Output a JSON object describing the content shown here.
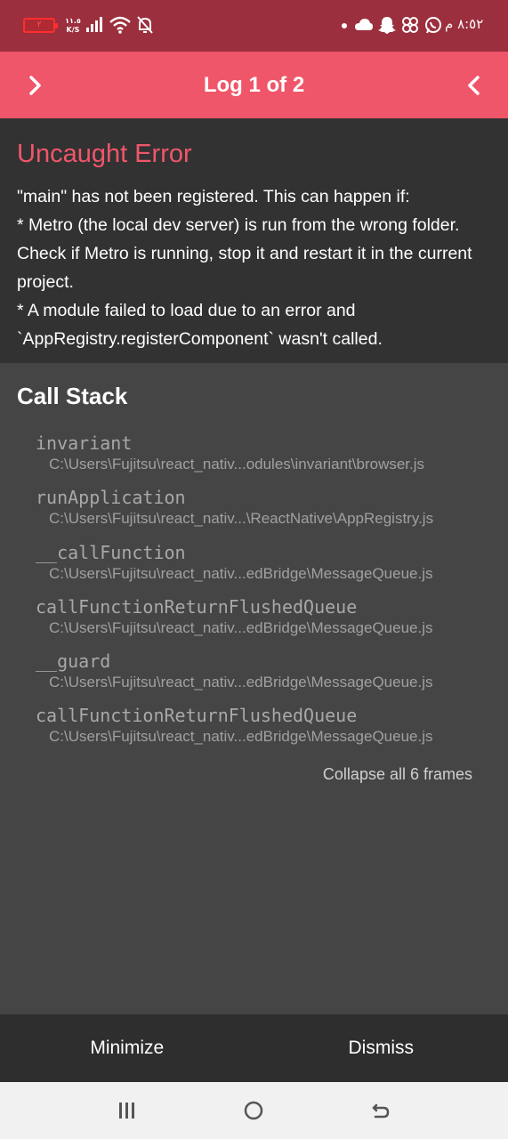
{
  "status_bar": {
    "battery_level": "٢",
    "net_speed_value": "١١.٥",
    "net_speed_unit": "K/S",
    "time": "٨:٥٢ م",
    "icons": [
      "signal-icon",
      "wifi-icon",
      "mute-icon",
      "dot-icon",
      "cloud-icon",
      "snapchat-icon",
      "share-icon",
      "whatsapp-icon"
    ]
  },
  "header": {
    "title": "Log 1 of 2",
    "prev_icon": "chevron-right-icon",
    "next_icon": "chevron-left-icon",
    "bg_color": "#f0566a"
  },
  "error": {
    "title": "Uncaught Error",
    "message": "\"main\" has not been registered. This can happen if:\n* Metro (the local dev server) is run from the wrong folder. Check if Metro is running, stop it and restart it in the current project.\n* A module failed to load due to an error and `AppRegistry.registerComponent` wasn't called.",
    "title_color": "#f0566a"
  },
  "call_stack": {
    "title": "Call Stack",
    "frames": [
      {
        "name": "invariant",
        "file": "C:\\Users\\Fujitsu\\react_nativ...odules\\invariant\\browser.js"
      },
      {
        "name": "runApplication",
        "file": "C:\\Users\\Fujitsu\\react_nativ...\\ReactNative\\AppRegistry.js"
      },
      {
        "name": "__callFunction",
        "file": "C:\\Users\\Fujitsu\\react_nativ...edBridge\\MessageQueue.js"
      },
      {
        "name": "callFunctionReturnFlushedQueue",
        "file": "C:\\Users\\Fujitsu\\react_nativ...edBridge\\MessageQueue.js"
      },
      {
        "name": "__guard",
        "file": "C:\\Users\\Fujitsu\\react_nativ...edBridge\\MessageQueue.js"
      },
      {
        "name": "callFunctionReturnFlushedQueue",
        "file": "C:\\Users\\Fujitsu\\react_nativ...edBridge\\MessageQueue.js"
      }
    ],
    "collapse_label": "Collapse all 6 frames"
  },
  "footer": {
    "minimize_label": "Minimize",
    "dismiss_label": "Dismiss"
  },
  "nav_bar": {
    "icons": [
      "recent-apps-icon",
      "home-icon",
      "back-icon"
    ]
  }
}
